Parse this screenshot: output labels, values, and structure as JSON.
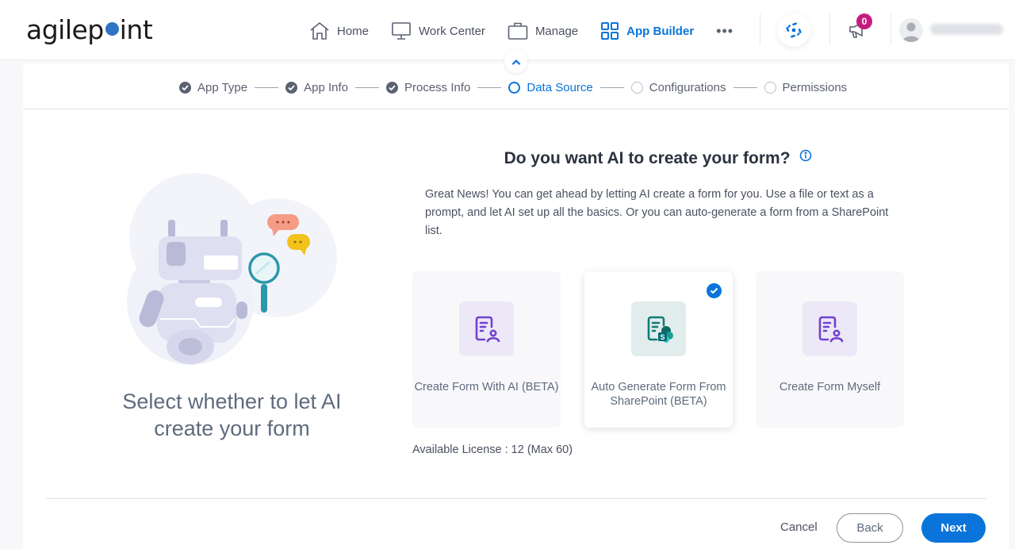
{
  "app": {
    "logo_prefix": "agilep",
    "logo_suffix": "int",
    "brand_color": "#2f74c4"
  },
  "nav": {
    "items": [
      {
        "label": "Home",
        "icon": "home-icon",
        "active": false
      },
      {
        "label": "Work Center",
        "icon": "monitor-icon",
        "active": false
      },
      {
        "label": "Manage",
        "icon": "briefcase-icon",
        "active": false
      },
      {
        "label": "App Builder",
        "icon": "grid-icon",
        "active": true
      }
    ],
    "more_label": "•••",
    "notification_count": "0",
    "accent_color": "#0a74da"
  },
  "stepper": {
    "steps": [
      {
        "label": "App Type",
        "status": "done"
      },
      {
        "label": "App Info",
        "status": "done"
      },
      {
        "label": "Process Info",
        "status": "done"
      },
      {
        "label": "Data Source",
        "status": "current"
      },
      {
        "label": "Configurations",
        "status": "pending"
      },
      {
        "label": "Permissions",
        "status": "pending"
      }
    ]
  },
  "left": {
    "caption": "Select whether to let AI create your form"
  },
  "main": {
    "question": "Do you want AI to create your form?",
    "description": "Great News! You can get ahead by letting AI create a form for you. Use a file or text as a prompt, and let AI set up all the basics. Or you can auto-generate a form from a SharePoint list.",
    "options": [
      {
        "label": "Create Form With AI (BETA)",
        "icon": "form-user-icon",
        "selected": false
      },
      {
        "label": "Auto Generate Form From SharePoint (BETA)",
        "icon": "form-sharepoint-icon",
        "selected": true
      },
      {
        "label": "Create Form Myself",
        "icon": "form-user-icon",
        "selected": false
      }
    ],
    "license_text": "Available License : 12 (Max 60)"
  },
  "footer": {
    "cancel_label": "Cancel",
    "back_label": "Back",
    "next_label": "Next"
  }
}
